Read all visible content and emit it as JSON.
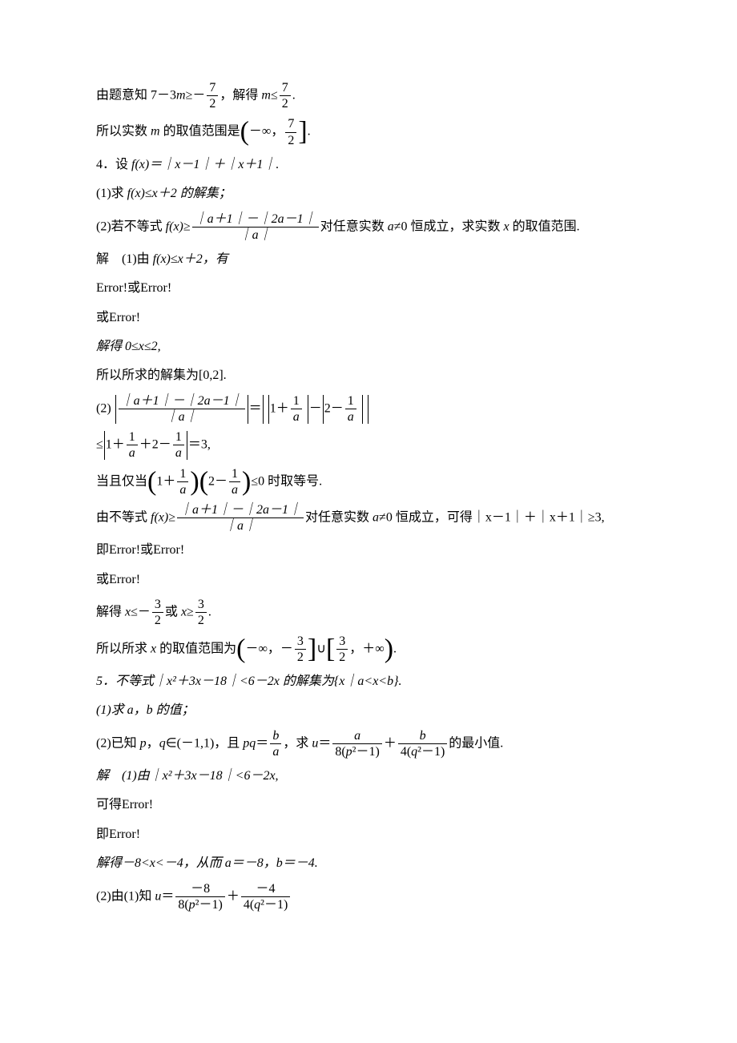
{
  "l1_a": "由题意知 7－3",
  "l1_b": "≥－",
  "l1_c": "，解得 ",
  "l1_d": "≤",
  "l1_e": ".",
  "m": "m",
  "seven": "7",
  "two": "2",
  "l2_a": "所以实数 ",
  "l2_b": " 的取值范围是",
  "l2_c": "－∞，",
  "l2_d": ".",
  "l3": "4．设 ",
  "l3_fx": "f",
  "l3_xp": "(x)＝｜x－1｜＋｜x＋1｜.",
  "l4_a": "(1)求 ",
  "l4_b": "f",
  "l4_c": "(x)≤x＋2 的解集；",
  "l5_a": "(2)若不等式 ",
  "l5_b": "f",
  "l5_c": "(x)≥",
  "l5_num": "｜a＋1｜－｜2a－1｜",
  "l5_den": "｜a｜",
  "l5_d": "对任意实数 ",
  "l5_e": "a",
  "l5_f": "≠0 恒成立，求实数 ",
  "l5_g": "x",
  "l5_h": " 的取值范围.",
  "l6_a": "解　(1)由 ",
  "l6_b": "f",
  "l6_c": "(x)≤x＋2，有",
  "l7": "Error!或Error!",
  "l8": "或Error!",
  "l9": "解得 0≤x≤2,",
  "l10": "所以所求的解集为[0,2].",
  "l11_a": "(2) ",
  "l11_num1": "｜a＋1｜－｜2a－1｜",
  "l11_den1": "｜a｜",
  "l11_eq": "＝",
  "l11_b": "1＋",
  "one": "1",
  "a": "a",
  "l11_minus": "－",
  "l11_c": "2－",
  "l12_a": "≤",
  "l12_b": "1＋",
  "l12_c": "＋2－",
  "l12_d": "＝3,",
  "l13_a": "当且仅当",
  "l13_b": "1＋",
  "l13_c": "2－",
  "l13_d": "≤0 时取等号.",
  "l14_a": "由不等式 ",
  "l14_b": "f",
  "l14_c": "(x)≥",
  "l14_d": "对任意实数 ",
  "l14_e": "a",
  "l14_f": "≠0 恒成立，可得｜x－1｜＋｜x＋1｜≥3,",
  "l15": "即Error!或Error!",
  "l16": "或Error!",
  "l17_a": "解得 ",
  "x": "x",
  "l17_b": "≤－",
  "three": "3",
  "l17_c": "或 ",
  "l17_d": "≥",
  "l17_e": ".",
  "l18_a": "所以所求 ",
  "l18_b": " 的取值范围为",
  "l18_c": "－∞，－",
  "l18_d": "∪",
  "l18_e": "，＋∞",
  "l18_f": ".",
  "l19": "5．不等式｜x²＋3x－18｜<6－2x 的解集为{x｜a<x<b}.",
  "l20": "(1)求 a，b 的值；",
  "l21_a": "(2)已知 ",
  "p": "p",
  "q": "q",
  "l21_b": "，",
  "l21_c": "∈(－1,1)，且 ",
  "pq": "pq",
  "l21_d": "＝",
  "b": "b",
  "l21_e": "，求 ",
  "u": "u",
  "l21_f": "＝",
  "l21_num1": "a",
  "l21_den1_a": "8(",
  "l21_den1_b": "p",
  "l21_den1_c": "²－1)",
  "l21_plus": "＋",
  "l21_num2": "b",
  "l21_den2_a": "4(",
  "l21_den2_b": "q",
  "l21_den2_c": "²－1)",
  "l21_g": "的最小值.",
  "l22": "解　(1)由｜x²＋3x－18｜<6－2x,",
  "l23": "可得Error!",
  "l24": "即Error!",
  "l25": "解得－8<x<－4，从而 a＝－8，b＝－4.",
  "l26_a": "(2)由(1)知 ",
  "l26_b": "＝",
  "l26_num1": "－8",
  "l26_num2": "－4"
}
